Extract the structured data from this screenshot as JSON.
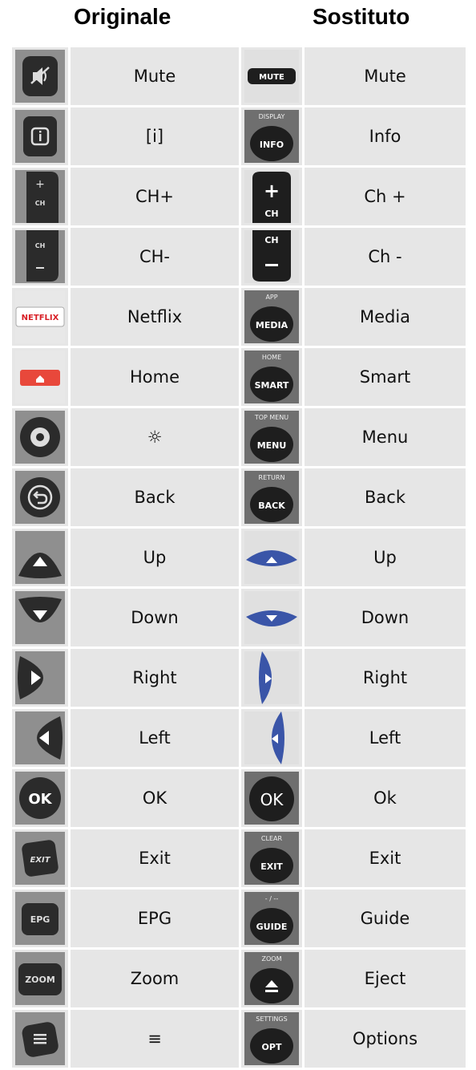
{
  "headers": {
    "original": "Originale",
    "replacement": "Sostituto"
  },
  "rows": [
    {
      "orig_label": "Mute",
      "repl_label": "Mute",
      "orig_icon": "mute-icon",
      "repl_icon": "mute-button-icon",
      "repl_top": "",
      "repl_text": "MUTE"
    },
    {
      "orig_label": "[i]",
      "repl_label": "Info",
      "orig_icon": "info-icon",
      "repl_icon": "info-button-icon",
      "repl_top": "DISPLAY",
      "repl_text": "INFO"
    },
    {
      "orig_label": "CH+",
      "repl_label": "Ch +",
      "orig_icon": "ch-plus-icon",
      "repl_icon": "ch-plus-icon",
      "repl_top": "",
      "repl_text": "CH"
    },
    {
      "orig_label": "CH-",
      "repl_label": "Ch -",
      "orig_icon": "ch-minus-icon",
      "repl_icon": "ch-minus-icon",
      "repl_top": "CH",
      "repl_text": ""
    },
    {
      "orig_label": "Netflix",
      "repl_label": "Media",
      "orig_icon": "netflix-icon",
      "repl_icon": "media-button-icon",
      "repl_top": "APP",
      "repl_text": "MEDIA"
    },
    {
      "orig_label": "Home",
      "repl_label": "Smart",
      "orig_icon": "home-icon",
      "repl_icon": "smart-button-icon",
      "repl_top": "HOME",
      "repl_text": "SMART"
    },
    {
      "orig_label": "☼",
      "repl_label": "Menu",
      "orig_icon": "settings-icon",
      "repl_icon": "menu-button-icon",
      "repl_top": "TOP MENU",
      "repl_text": "MENU"
    },
    {
      "orig_label": "Back",
      "repl_label": "Back",
      "orig_icon": "back-icon",
      "repl_icon": "back-button-icon",
      "repl_top": "RETURN",
      "repl_text": "BACK"
    },
    {
      "orig_label": "Up",
      "repl_label": "Up",
      "orig_icon": "up-arrow-icon",
      "repl_icon": "up-arrow-icon",
      "repl_top": "",
      "repl_text": ""
    },
    {
      "orig_label": "Down",
      "repl_label": "Down",
      "orig_icon": "down-arrow-icon",
      "repl_icon": "down-arrow-icon",
      "repl_top": "",
      "repl_text": ""
    },
    {
      "orig_label": "Right",
      "repl_label": "Right",
      "orig_icon": "right-arrow-icon",
      "repl_icon": "right-arrow-icon",
      "repl_top": "",
      "repl_text": ""
    },
    {
      "orig_label": "Left",
      "repl_label": "Left",
      "orig_icon": "left-arrow-icon",
      "repl_icon": "left-arrow-icon",
      "repl_top": "",
      "repl_text": ""
    },
    {
      "orig_label": "OK",
      "repl_label": "Ok",
      "orig_icon": "ok-icon",
      "repl_icon": "ok-icon",
      "repl_top": "",
      "repl_text": "OK"
    },
    {
      "orig_label": "Exit",
      "repl_label": "Exit",
      "orig_icon": "exit-icon",
      "repl_icon": "exit-button-icon",
      "repl_top": "CLEAR",
      "repl_text": "EXIT"
    },
    {
      "orig_label": "EPG",
      "repl_label": "Guide",
      "orig_icon": "epg-icon",
      "repl_icon": "guide-button-icon",
      "repl_top": "- / --",
      "repl_text": "GUIDE"
    },
    {
      "orig_label": "Zoom",
      "repl_label": "Eject",
      "orig_icon": "zoom-icon",
      "repl_icon": "eject-icon",
      "repl_top": "ZOOM",
      "repl_text": ""
    },
    {
      "orig_label": "≡",
      "repl_label": "Options",
      "orig_icon": "menu-lines-icon",
      "repl_icon": "options-button-icon",
      "repl_top": "SETTINGS",
      "repl_text": "OPT"
    }
  ],
  "original_icon_texts": {
    "netflix": "NETFLIX",
    "exit": "EXIT",
    "epg": "EPG",
    "zoom": "ZOOM",
    "ok": "OK",
    "ch": "CH"
  },
  "colors": {
    "cell": "#e6e6e6",
    "netflix_red": "#d81f26",
    "home_red": "#e8483b",
    "arrow_blue": "#3a55a8"
  }
}
